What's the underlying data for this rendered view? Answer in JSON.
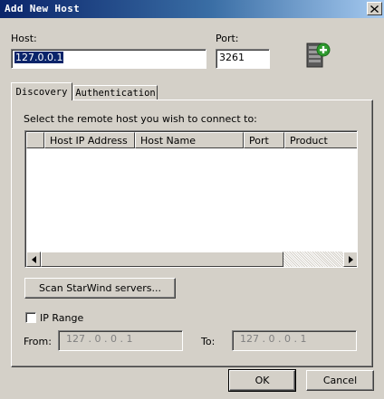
{
  "window": {
    "title": "Add New Host"
  },
  "host": {
    "label": "Host:",
    "value": "127.0.0.1"
  },
  "port": {
    "label": "Port:",
    "value": "3261"
  },
  "tabs": [
    {
      "label": "Discovery",
      "active": true
    },
    {
      "label": "Authentication",
      "active": false
    }
  ],
  "discovery": {
    "instruction": "Select the remote host you wish to connect to:",
    "columns": [
      "Host IP Address",
      "Host Name",
      "Port",
      "Product"
    ],
    "scan_button": "Scan StarWind servers...",
    "ip_range": {
      "label": "IP Range",
      "checked": false,
      "from_label": "From:",
      "from_value": "127 .  0  .  0  .  1",
      "to_label": "To:",
      "to_value": "127 .  0  .  0  .  1"
    }
  },
  "buttons": {
    "ok": "OK",
    "cancel": "Cancel"
  },
  "colors": {
    "titlebar_start": "#0a246a",
    "titlebar_end": "#a6caf0",
    "face": "#d4d0c8",
    "selection": "#0a246a",
    "add_badge": "#2e9a2e"
  },
  "icons": {
    "add_host": "server-add-icon",
    "close": "close-icon"
  }
}
